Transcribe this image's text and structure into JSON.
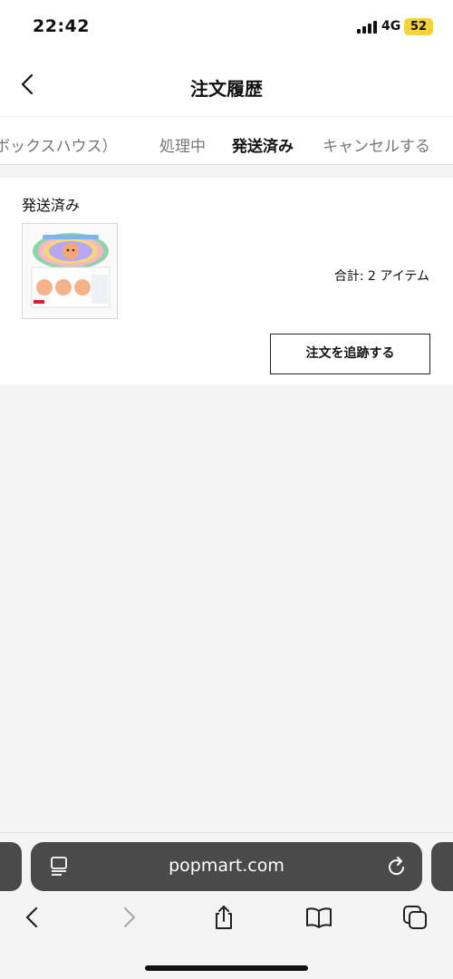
{
  "status_bar": {
    "time": "22:42",
    "network": "4G",
    "battery": "52",
    "battery_color": "#f5d33d"
  },
  "header": {
    "title": "注文履歴",
    "back_icon": "chevron-left-icon"
  },
  "tabs": [
    {
      "label": "ボックスハウス）",
      "active": false
    },
    {
      "label": "処理中",
      "active": false
    },
    {
      "label": "発送済み",
      "active": true
    },
    {
      "label": "キャンセルする",
      "active": false
    }
  ],
  "accent_color": "#d62030",
  "order": {
    "status": "発送済み",
    "total": "合計: 2 アイテム",
    "track_button": "注文を追跡する"
  },
  "browser": {
    "url": "popmart.com",
    "icons": [
      "reader-icon",
      "reload-icon",
      "back-icon",
      "forward-icon",
      "share-icon",
      "bookmarks-icon",
      "tabs-icon"
    ]
  }
}
